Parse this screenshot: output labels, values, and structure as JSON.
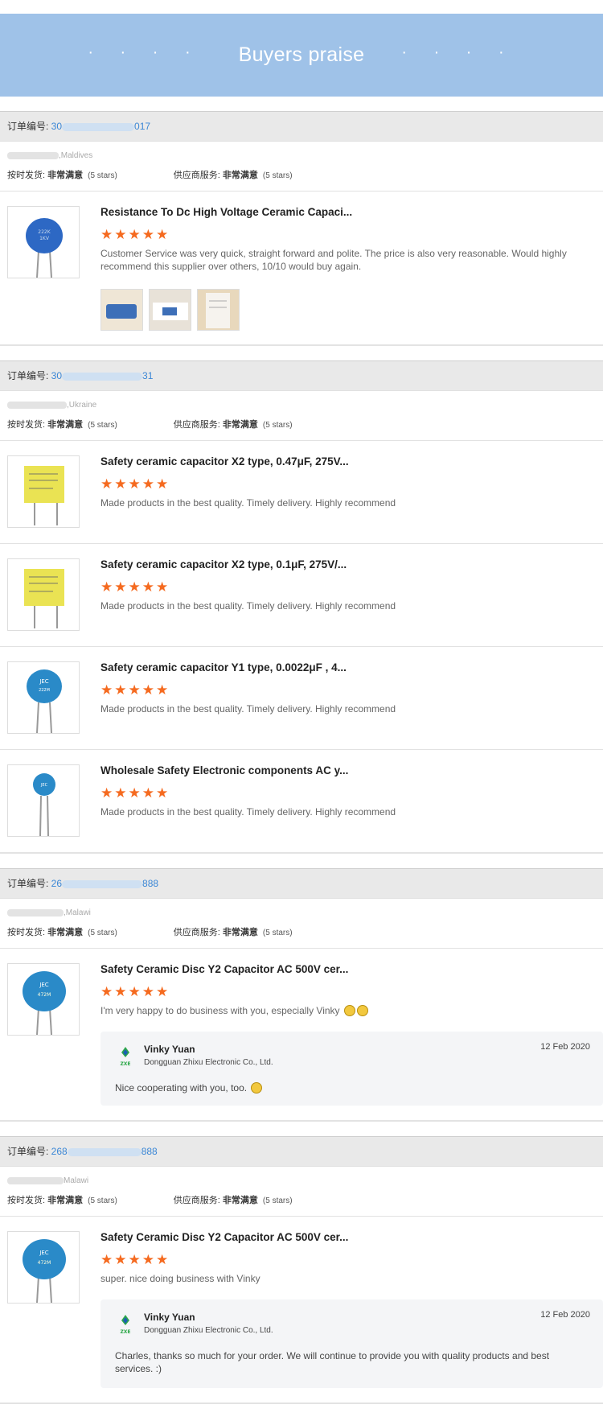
{
  "header": {
    "title": "Buyers praise",
    "dots": "· · · ·"
  },
  "common": {
    "order_label": "订单编号: ",
    "ontime_label": "按时发货: ",
    "service_label": "供应商服务: ",
    "rating_value": "非常满意",
    "rating_stars": "(5 stars)",
    "stars": "★★★★★"
  },
  "orders": [
    {
      "order_prefix": "30",
      "order_suffix": "017",
      "country": ",Maldives",
      "items": [
        {
          "title": "Resistance To Dc High Voltage Ceramic Capaci...",
          "review": "Customer Service was very quick, straight forward and polite. The price is also very reasonable. Would highly recommend this supplier over others, 10/10 would buy again."
        }
      ]
    },
    {
      "order_prefix": "30",
      "order_suffix": "31",
      "country": ",Ukraine",
      "items": [
        {
          "title": "Safety ceramic capacitor X2 type, 0.47μF, 275V...",
          "review": "Made products in the best quality. Timely delivery. Highly recommend"
        },
        {
          "title": "Safety ceramic capacitor X2 type, 0.1μF, 275V/...",
          "review": "Made products in the best quality. Timely delivery. Highly recommend"
        },
        {
          "title": "Safety ceramic capacitor Y1 type, 0.0022μF , 4...",
          "review": "Made products in the best quality. Timely delivery. Highly recommend"
        },
        {
          "title": "Wholesale Safety Electronic components AC y...",
          "review": "Made products in the best quality. Timely delivery. Highly recommend"
        }
      ]
    },
    {
      "order_prefix": "26",
      "order_suffix": "888",
      "country": ",Malawi",
      "items": [
        {
          "title": "Safety Ceramic Disc Y2 Capacitor AC 500V cer...",
          "review": "I'm very happy to do business with you, especially Vinky"
        }
      ],
      "reply": {
        "name": "Vinky Yuan",
        "company": "Dongguan Zhixu Electronic Co., Ltd.",
        "date": "12 Feb 2020",
        "text": "Nice cooperating with you, too."
      }
    },
    {
      "order_prefix": "268",
      "order_suffix": "888",
      "country": "Malawi",
      "items": [
        {
          "title": "Safety Ceramic Disc Y2 Capacitor AC 500V cer...",
          "review": "super. nice doing business with Vinky"
        }
      ],
      "reply": {
        "name": "Vinky Yuan",
        "company": "Dongguan Zhixu Electronic Co., Ltd.",
        "date": "12 Feb 2020",
        "text": "Charles, thanks so much for your order. We will continue to provide you with quality products and best services. :)"
      }
    }
  ]
}
